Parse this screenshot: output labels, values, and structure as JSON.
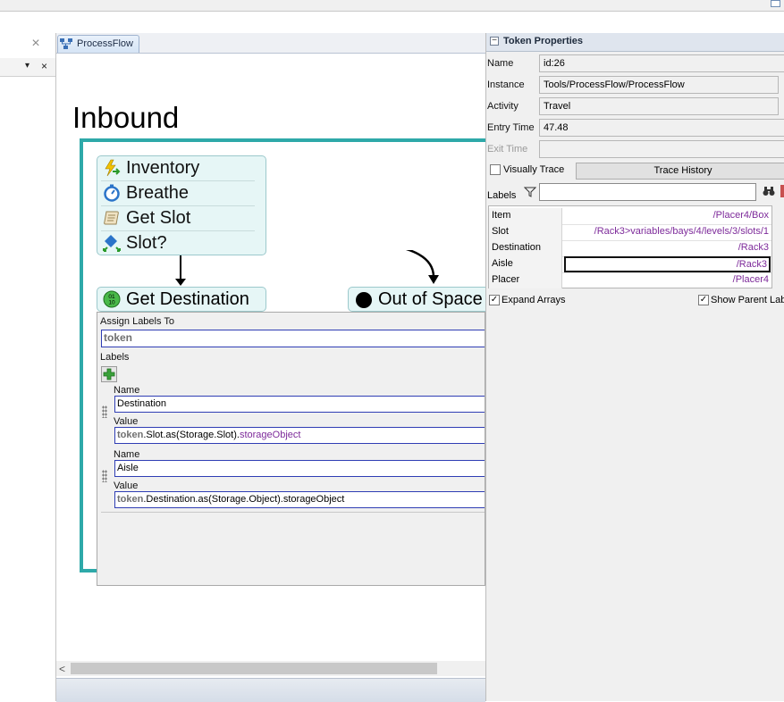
{
  "left_panel": {
    "close_glyph": "×",
    "dropdown_glyph": "▾",
    "close_small_glyph": "×"
  },
  "document": {
    "tab_label": "ProcessFlow",
    "title": "Inbound",
    "stack_activities": [
      {
        "label": "Inventory",
        "icon": "lightning-arrow-icon"
      },
      {
        "label": "Breathe",
        "icon": "stopwatch-icon"
      },
      {
        "label": "Get Slot",
        "icon": "scroll-icon"
      },
      {
        "label": "Slot?",
        "icon": "decision-diamond-icon"
      }
    ],
    "get_destination": {
      "label": "Get Destination",
      "icon": "binary-circle-icon",
      "icon_text": "01\n10"
    },
    "out_of_space": {
      "label": "Out of Space",
      "icon": "sink-dot-icon"
    }
  },
  "quick_properties": {
    "assign_to_label": "Assign Labels To",
    "assign_to_value": "token",
    "labels_heading": "Labels",
    "entries": [
      {
        "name_caption": "Name",
        "name_value": "Destination",
        "value_caption": "Value",
        "value_kw": "token",
        "value_mid": ".Slot.as(Storage.Slot).",
        "value_tail": "storageObject"
      },
      {
        "name_caption": "Name",
        "name_value": "Aisle",
        "value_caption": "Value",
        "value_kw": "token",
        "value_mid": ".Destination.as(Storage.Object).storageObject",
        "value_tail": ""
      }
    ]
  },
  "scrollbar": {
    "left_arrow": "<"
  },
  "token_properties": {
    "title": "Token Properties",
    "collapse_glyph": "−",
    "fields": {
      "name": {
        "label": "Name",
        "value": "id:26"
      },
      "instance": {
        "label": "Instance",
        "value": "Tools/ProcessFlow/ProcessFlow"
      },
      "activity": {
        "label": "Activity",
        "value": "Travel"
      },
      "entry_time": {
        "label": "Entry Time",
        "value": "47.48"
      },
      "exit_time": {
        "label": "Exit Time",
        "value": ""
      }
    },
    "visually_trace_label": "Visually Trace",
    "trace_history_label": "Trace History",
    "labels_caption": "Labels",
    "labels_filter_value": "",
    "labels": [
      {
        "name": "Item",
        "value": "/Placer4/Box"
      },
      {
        "name": "Slot",
        "value": "/Rack3>variables/bays/4/levels/3/slots/1"
      },
      {
        "name": "Destination",
        "value": "/Rack3"
      },
      {
        "name": "Aisle",
        "value": "/Rack3"
      },
      {
        "name": "Placer",
        "value": "/Placer4"
      }
    ],
    "expand_arrays_label": "Expand Arrays",
    "show_parent_label": "Show Parent Labels",
    "check_glyph": "✓"
  },
  "colors": {
    "container_border": "#2ea9a9",
    "activity_fill": "#e6f6f6",
    "field_border": "#2f3db4",
    "label_value_purple": "#7d2a9a"
  }
}
